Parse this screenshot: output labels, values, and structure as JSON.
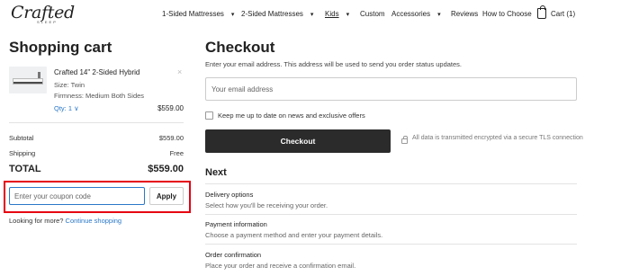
{
  "header": {
    "logo": "Crafted",
    "logo_sub": "SLEEP",
    "nav": [
      {
        "label": "1-Sided Mattresses",
        "has_caret": true
      },
      {
        "label": "2-Sided Mattresses",
        "has_caret": true
      },
      {
        "label": "Kids",
        "has_caret": true
      },
      {
        "label": "Custom",
        "has_caret": false
      },
      {
        "label": "Accessories",
        "has_caret": true
      },
      {
        "label": "Reviews",
        "has_caret": false
      },
      {
        "label": "How to Choose",
        "has_caret": false
      }
    ],
    "caret": "▾",
    "cart_label": "Cart (1)"
  },
  "cart": {
    "title": "Shopping cart",
    "item": {
      "name": "Crafted 14\" 2-Sided Hybrid",
      "size": "Size: Twin",
      "firmness": "Firmness: Medium Both Sides",
      "qty": "Qty: 1 ∨",
      "price": "$559.00",
      "remove": "×"
    },
    "subtotal_label": "Subtotal",
    "subtotal_value": "$559.00",
    "shipping_label": "Shipping",
    "shipping_value": "Free",
    "total_label": "TOTAL",
    "total_value": "$559.00",
    "coupon_placeholder": "Enter your coupon code",
    "coupon_value": "",
    "apply_label": "Apply",
    "more_text": "Looking for more? ",
    "more_link": "Continue shopping"
  },
  "checkout": {
    "title": "Checkout",
    "email_help": "Enter your email address. This address will be used to send you order status updates.",
    "email_placeholder": "Your email address",
    "email_value": "",
    "newsletter_label": "Keep me up to date on news and exclusive offers",
    "newsletter_checked": false,
    "button_label": "Checkout",
    "secure_text": "All data is transmitted encrypted via a secure TLS connection"
  },
  "next": {
    "title": "Next",
    "steps": [
      {
        "title": "Delivery options",
        "desc": "Select how you'll be receiving your order."
      },
      {
        "title": "Payment information",
        "desc": "Choose a payment method and enter your payment details."
      },
      {
        "title": "Order confirmation",
        "desc": "Place your order and receive a confirmation email."
      }
    ]
  },
  "colors": {
    "accent_link": "#2a78c8",
    "highlight_border": "#e60012",
    "checkout_button": "#2b2b2b"
  }
}
